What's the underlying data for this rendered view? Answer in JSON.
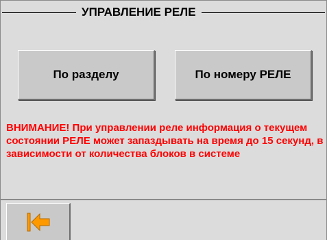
{
  "panel": {
    "title": "УПРАВЛЕНИЕ РЕЛЕ"
  },
  "buttons": {
    "by_section": "По разделу",
    "by_relay_number": "По номеру РЕЛЕ"
  },
  "warning": {
    "text": "ВНИМАНИЕ! При управлении реле информация о текущем состоянии РЕЛЕ может запаздывать на время до 15 секунд, в зависимости от количества блоков в системе"
  },
  "footer": {
    "back_icon": "back-to-start-icon"
  },
  "colors": {
    "background": "#dcdcdc",
    "button": "#c9c9c9",
    "warning": "#ff0000",
    "icon": "#ff9900"
  }
}
